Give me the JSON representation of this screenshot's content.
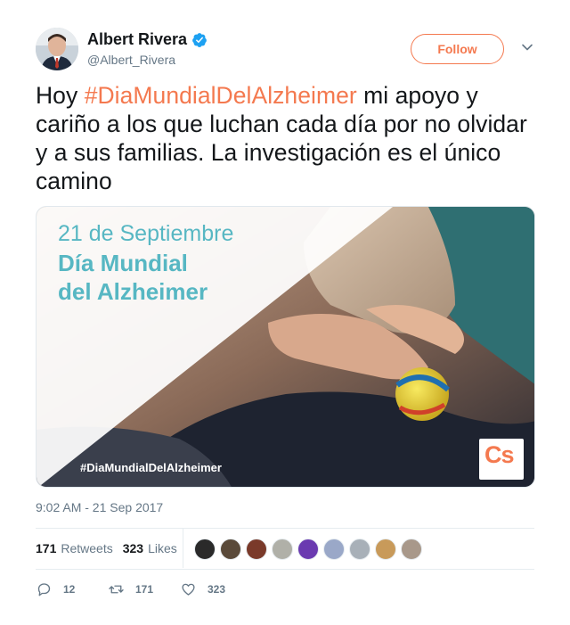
{
  "author": {
    "name": "Albert Rivera",
    "handle": "@Albert_Rivera",
    "verified": true
  },
  "follow_label": "Follow",
  "tweet": {
    "text_before": "Hoy ",
    "hashtag": "#DiaMundialDelAlzheimer",
    "text_after": " mi apoyo y cariño a los que luchan cada día por no olvidar y a sus familias. La investigación es el único camino"
  },
  "media": {
    "line1": "21 de Septiembre",
    "line2": "Día Mundial",
    "line3": "del Alzheimer",
    "hashtag": "#DiaMundialDelAlzheimer",
    "logo": "Cs"
  },
  "timestamp": "9:02 AM - 21 Sep 2017",
  "stats": {
    "retweets_count": "171",
    "retweets_label": "Retweets",
    "likes_count": "323",
    "likes_label": "Likes"
  },
  "actions": {
    "replies": "12",
    "retweets": "171",
    "likes": "323"
  },
  "colors": {
    "accent": "#f4794f",
    "verified": "#1da1f2",
    "secondary_text": "#657786",
    "teal": "#57b7c3"
  },
  "icons": [
    "verified-badge-icon",
    "chevron-down-icon",
    "reply-icon",
    "retweet-icon",
    "heart-icon"
  ]
}
